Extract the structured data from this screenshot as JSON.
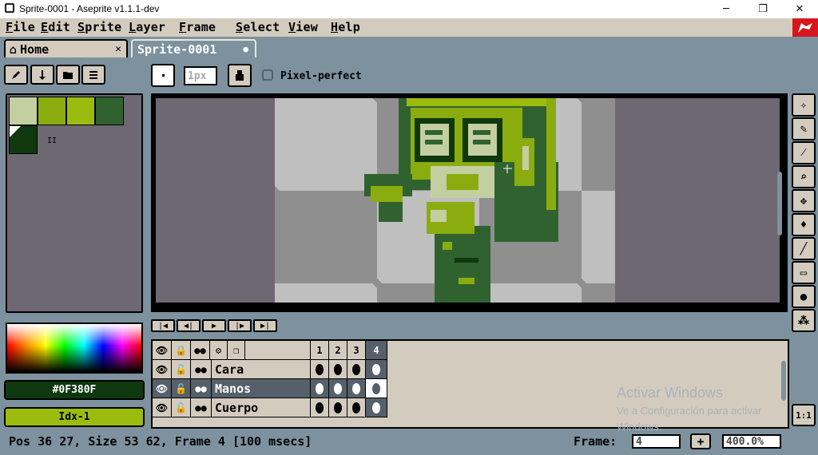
{
  "window": {
    "title": "Sprite-0001 - Aseprite v1.1.1-dev",
    "min_icon": "─",
    "max_icon": "❐",
    "close_icon": "✕"
  },
  "menu": [
    "File",
    "Edit",
    "Sprite",
    "Layer",
    "Frame",
    "Select",
    "View",
    "Help"
  ],
  "tabs": {
    "home_label": "Home",
    "home_icon": "⌂",
    "home_close": "✕",
    "sprite_label": "Sprite-0001",
    "sprite_modified": "●"
  },
  "toolbar": {
    "brush_size": "1px",
    "pixel_perfect_label": "Pixel-perfect",
    "pixel_perfect_checked": false
  },
  "palette": {
    "colors": [
      "#c4cfa1",
      "#8bac0f",
      "#9bbc0f",
      "#306230",
      "#0f380f"
    ],
    "fg_bg_marker": "II"
  },
  "color_bar": {
    "hex": "#0F380F",
    "index": "Idx-1"
  },
  "timeline": {
    "frames": [
      "1",
      "2",
      "3",
      "4"
    ],
    "active_frame": "4",
    "layers": [
      {
        "name": "Cara",
        "selected": false
      },
      {
        "name": "Manos",
        "selected": true
      },
      {
        "name": "Cuerpo",
        "selected": false
      }
    ]
  },
  "status": {
    "info": "Pos 36 27, Size 53 62, Frame 4 [100 msecs]",
    "frame_label": "Frame:",
    "frame_value": "4",
    "add_frame": "+",
    "zoom": "400.0%"
  },
  "overlay": {
    "activate_title": "Activar Windows",
    "activate_sub": "Ve a Configuración para activar",
    "activate_sub2": "Windows."
  },
  "zoom_reset_label": "1:1",
  "colors": {
    "ui_bg": "#7d929e",
    "panel": "#d3cbbe",
    "canvas_bg": "#6e6873",
    "dark_green": "#0f380f",
    "light_green": "#9bbc0f"
  }
}
